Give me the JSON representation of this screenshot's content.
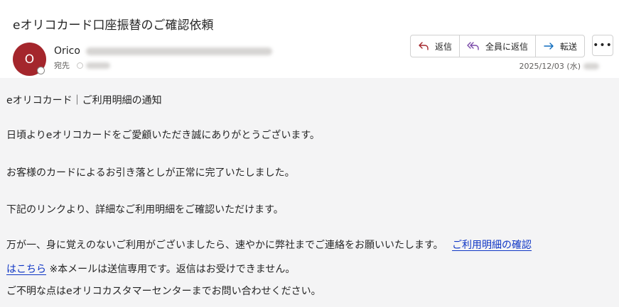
{
  "email": {
    "subject": "eオリコカード口座振替のご確認依頼",
    "sender_name": "Orico",
    "avatar_initial": "O",
    "to_label": "宛先",
    "date": "2025/12/03 (水)"
  },
  "toolbar": {
    "reply_label": "返信",
    "reply_all_label": "全員に返信",
    "forward_label": "転送",
    "more_label": "•••"
  },
  "body": {
    "heading": "eオリコカード｜ご利用明細の通知",
    "p1": "日頃よりeオリコカードをご愛顧いただき誠にありがとうございます。",
    "p2": "お客様のカードによるお引き落としが正常に完了いたしました。",
    "p3": "下記のリンクより、詳細なご利用明細をご確認いただけます。",
    "p4_text": "万が一、身に覚えのないご利用がございましたら、速やかに弊社までご連絡をお願いいたします。",
    "link_part1": "ご利用明細の確認",
    "link_part2": "はこちら",
    "p4_note": " ※本メールは送信専用です。返信はお受けできません。",
    "p5": "ご不明な点はeオリコカスタマーセンターまでお問い合わせください。"
  },
  "colors": {
    "avatar_bg": "#a4262c",
    "reply_icon": "#a4262c",
    "reply_all_icon": "#7a4aa8",
    "forward_icon": "#0f6cbd",
    "link": "#0f36c5"
  }
}
